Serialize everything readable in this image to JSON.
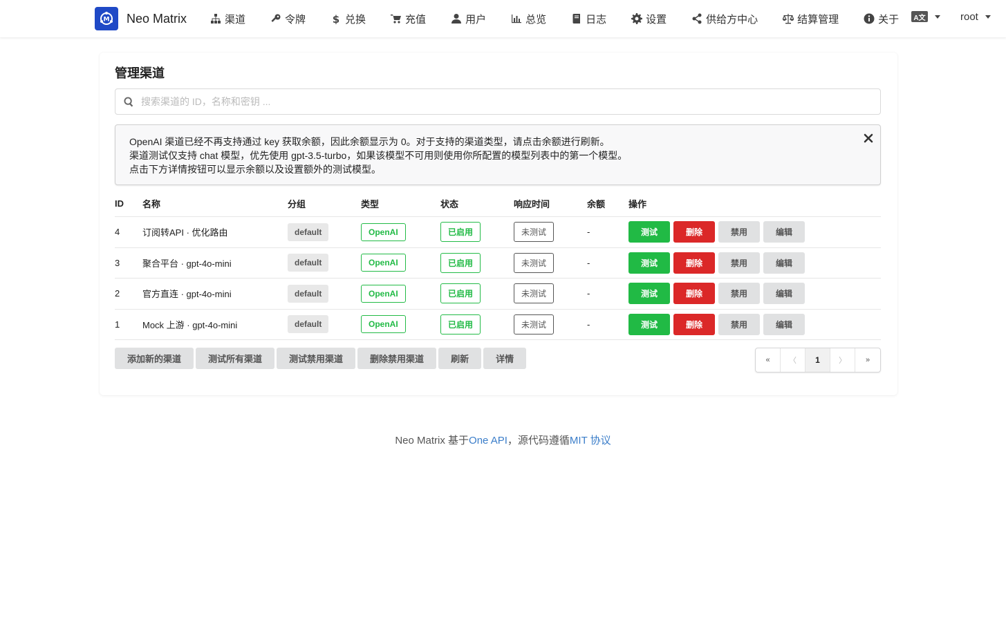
{
  "header": {
    "brand_name": "Neo Matrix",
    "nav": [
      {
        "label": "渠道",
        "icon": "sitemap-icon"
      },
      {
        "label": "令牌",
        "icon": "key-icon"
      },
      {
        "label": "兑换",
        "icon": "dollar-icon"
      },
      {
        "label": "充值",
        "icon": "cart-icon"
      },
      {
        "label": "用户",
        "icon": "user-icon"
      },
      {
        "label": "总览",
        "icon": "bar-chart-icon"
      },
      {
        "label": "日志",
        "icon": "book-icon"
      },
      {
        "label": "设置",
        "icon": "gear-icon"
      },
      {
        "label": "供给方中心",
        "icon": "share-icon"
      },
      {
        "label": "结算管理",
        "icon": "balance-scale-icon"
      },
      {
        "label": "关于",
        "icon": "info-icon"
      }
    ],
    "lang_badge": "A文",
    "user_name": "root"
  },
  "main": {
    "title": "管理渠道",
    "search_placeholder": "搜索渠道的 ID，名称和密钥 ...",
    "notice": [
      "OpenAI 渠道已经不再支持通过 key 获取余额，因此余额显示为 0。对于支持的渠道类型，请点击余额进行刷新。",
      "渠道测试仅支持 chat 模型，优先使用 gpt-3.5-turbo，如果该模型不可用则使用你所配置的模型列表中的第一个模型。",
      "点击下方详情按钮可以显示余额以及设置额外的测试模型。"
    ],
    "table": {
      "headers": {
        "id": "ID",
        "name": "名称",
        "group": "分组",
        "type": "类型",
        "status": "状态",
        "response": "响应时间",
        "balance": "余额",
        "ops": "操作"
      },
      "rows": [
        {
          "id": "4",
          "name": "订阅转API · 优化路由",
          "group": "default",
          "type": "OpenAI",
          "status": "已启用",
          "response": "未测试",
          "balance": "-"
        },
        {
          "id": "3",
          "name": "聚合平台 · gpt-4o-mini",
          "group": "default",
          "type": "OpenAI",
          "status": "已启用",
          "response": "未测试",
          "balance": "-"
        },
        {
          "id": "2",
          "name": "官方直连 · gpt-4o-mini",
          "group": "default",
          "type": "OpenAI",
          "status": "已启用",
          "response": "未测试",
          "balance": "-"
        },
        {
          "id": "1",
          "name": "Mock 上游 · gpt-4o-mini",
          "group": "default",
          "type": "OpenAI",
          "status": "已启用",
          "response": "未测试",
          "balance": "-"
        }
      ],
      "ops": {
        "test": "测试",
        "delete": "删除",
        "disable": "禁用",
        "edit": "编辑"
      }
    },
    "bottom_buttons": [
      "添加新的渠道",
      "测试所有渠道",
      "测试禁用渠道",
      "删除禁用渠道",
      "刷新",
      "详情"
    ],
    "pagination": {
      "first": "«",
      "prev": "〈",
      "current": "1",
      "next": "〉",
      "last": "»"
    }
  },
  "footer": {
    "prefix": "Neo Matrix 基于",
    "link1": "One API",
    "middle": "，源代码遵循",
    "link2": "MIT 协议"
  },
  "colors": {
    "accent": "#21ba45",
    "danger": "#db2828",
    "logo": "#1f49c6",
    "link": "#3a7dc9"
  }
}
